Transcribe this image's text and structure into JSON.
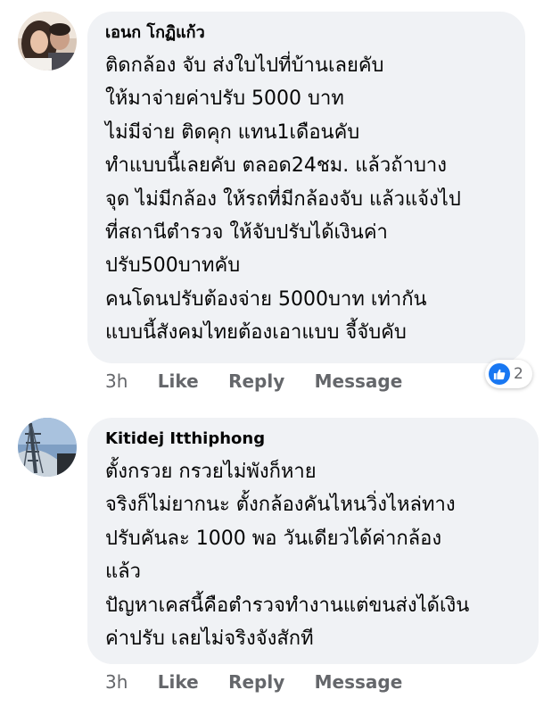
{
  "comments": [
    {
      "author": "เอนก โกฏิแก้ว",
      "lines": [
        "ติดกล้อง จับ ส่งใบไปที่บ้านเลยคับ",
        "ให้มาจ่ายค่าปรับ 5000 บาท",
        "ไม่มีจ่าย ติดคุก แทน1เดือนคับ",
        "ทำแบบนี้เลยคับ ตลอด24ชม. แล้วถ้าบาง",
        "จุด ไม่มีกล้อง ให้รถที่มีกล้องจับ แล้วแจ้งไป",
        "ที่สถานีตำรวจ ให้จับปรับได้เงินค่า",
        "ปรับ500บาทคับ",
        "คนโดนปรับต้องจ่าย 5000บาท เท่ากัน",
        "แบบนี้สังคมไทยต้องเอาแบบ จี้จับคับ"
      ],
      "time": "3h",
      "like_label": "Like",
      "reply_label": "Reply",
      "message_label": "Message",
      "reaction_icon": "like-reaction-icon",
      "reaction_count": "2"
    },
    {
      "author": "Kitidej Itthiphong",
      "lines": [
        "ตั้งกรวย กรวยไม่พังก็หาย",
        "จริงก็ไม่ยากนะ ตั้งกล้องคันไหนวิ่งไหล่ทาง",
        "ปรับคันละ 1000 พอ วันเดียวได้ค่ากล้อง",
        "แล้ว",
        "ปัญหาเคสนี้คือตำรวจทำงานแต่ขนส่งได้เงิน",
        "ค่าปรับ เลยไม่จริงจังสักที"
      ],
      "time": "3h",
      "like_label": "Like",
      "reply_label": "Reply",
      "message_label": "Message"
    }
  ],
  "colors": {
    "bubble": "#f0f2f5",
    "text": "#050505",
    "secondary": "#65676b",
    "like_blue": "#1877f2"
  }
}
